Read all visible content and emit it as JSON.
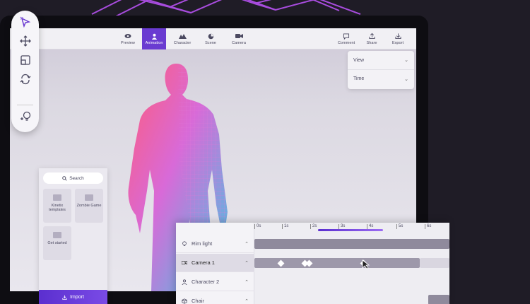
{
  "toolbar": {
    "tabs": [
      {
        "label": "Preview",
        "icon": "eye-icon"
      },
      {
        "label": "Animation",
        "icon": "person-icon",
        "active": true
      },
      {
        "label": "Character",
        "icon": "character-icon"
      },
      {
        "label": "Scene",
        "icon": "scene-icon"
      },
      {
        "label": "Camera",
        "icon": "camera-icon"
      }
    ],
    "actions": [
      {
        "label": "Comment",
        "icon": "comment-icon"
      },
      {
        "label": "Share",
        "icon": "share-icon"
      },
      {
        "label": "Export",
        "icon": "export-icon"
      }
    ]
  },
  "panel": {
    "view_label": "View",
    "time_label": "Time"
  },
  "assets": {
    "search_placeholder": "Search",
    "items": [
      "Kinetix templates",
      "Zombie Game",
      "Get started"
    ],
    "import_label": "Import"
  },
  "timeline": {
    "tracks": [
      "Rim light",
      "Camera 1",
      "Character 2",
      "Chair"
    ],
    "selected_track": "Camera 1",
    "ruler": [
      "0s",
      "1s",
      "2s",
      "3s",
      "4s",
      "5s",
      "6s"
    ]
  },
  "colors": {
    "accent": "#6a3bd1",
    "background": "#1f1c26"
  }
}
